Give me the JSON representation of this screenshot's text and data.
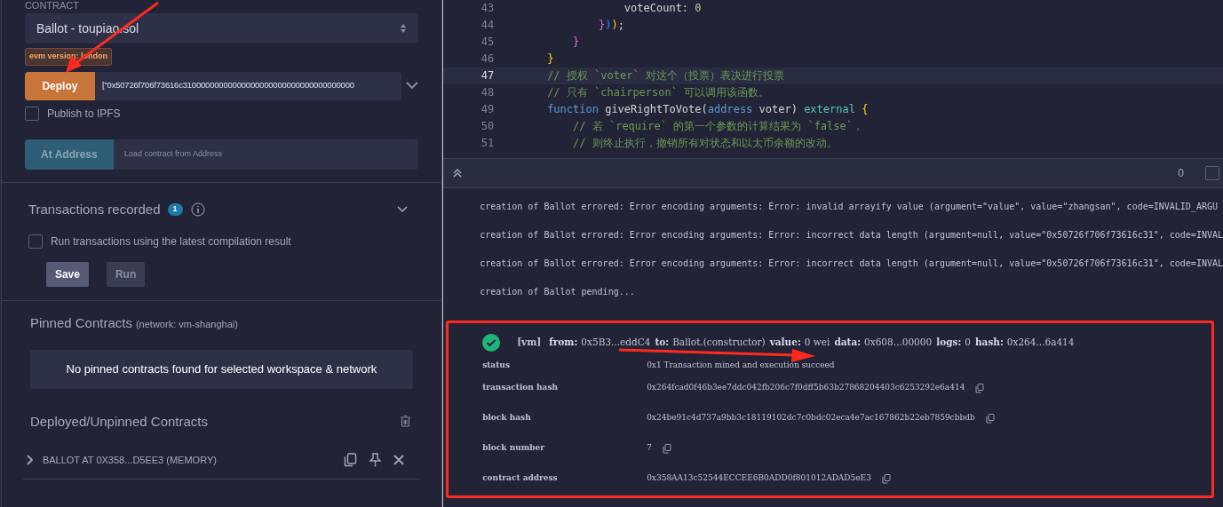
{
  "left_panel": {
    "contract_label": "CONTRACT",
    "contract_select": "Ballot - toupiao.sol",
    "evm_badge": "evm version: london",
    "deploy_button": "Deploy",
    "deploy_args": "[\"0x50726f706f73616c31000000000000000000000000000000000000",
    "publish_ipfs": {
      "label": "Publish to IPFS",
      "checked": false
    },
    "at_address_button": "At Address",
    "at_address_placeholder": "Load contract from Address",
    "transactions": {
      "title": "Transactions recorded",
      "count": "1",
      "expanded": false,
      "run_latest": {
        "label": "Run transactions using the latest compilation result",
        "checked": false
      },
      "buttons": [
        {
          "label": "Save",
          "disabled": false
        },
        {
          "label": "Run",
          "disabled": true
        }
      ]
    },
    "pinned": {
      "title": "Pinned Contracts",
      "network": "(network: vm-shanghai)",
      "empty_message": "No pinned contracts found for selected workspace & network"
    },
    "deployed": {
      "title": "Deployed/Unpinned Contracts",
      "items": [
        {
          "label": "BALLOT AT 0X358...D5EE3 (MEMORY)",
          "expanded": false
        }
      ]
    }
  },
  "editor": {
    "lines": [
      {
        "number": "43",
        "current": false,
        "tokens": [
          {
            "text": "            voteCount: ",
            "kind": "plain"
          },
          {
            "text": "0",
            "kind": "number"
          }
        ]
      },
      {
        "number": "44",
        "current": false,
        "tokens": [
          {
            "text": "        }",
            "kind": "bracket2"
          },
          {
            "text": ")",
            "kind": "bracket3"
          },
          {
            "text": ")",
            "kind": "bracket1"
          },
          {
            "text": ";",
            "kind": "plain"
          }
        ]
      },
      {
        "number": "45",
        "current": false,
        "tokens": [
          {
            "text": "    }",
            "kind": "bracket2"
          }
        ]
      },
      {
        "number": "46",
        "current": false,
        "tokens": [
          {
            "text": "}",
            "kind": "bracket1"
          }
        ]
      },
      {
        "number": "47",
        "current": true,
        "tokens": [
          {
            "text": "// 授权 `voter` 对这个（投票）表决进行投票",
            "kind": "comment"
          }
        ]
      },
      {
        "number": "48",
        "current": false,
        "tokens": [
          {
            "text": "// 只有 `chairperson` 可以调用该函数。",
            "kind": "comment"
          }
        ]
      },
      {
        "number": "49",
        "current": false,
        "tokens": [
          {
            "text": "function",
            "kind": "keyword"
          },
          {
            "text": " giveRightToVote(",
            "kind": "plain"
          },
          {
            "text": "address",
            "kind": "keyword"
          },
          {
            "text": " voter) ",
            "kind": "plain"
          },
          {
            "text": "external",
            "kind": "modifier"
          },
          {
            "text": " {",
            "kind": "bracket1"
          }
        ]
      },
      {
        "number": "50",
        "current": false,
        "tokens": [
          {
            "text": "    // 若 `require` 的第一个参数的计算结果为 `false`，",
            "kind": "comment"
          }
        ]
      },
      {
        "number": "51",
        "current": false,
        "tokens": [
          {
            "text": "    // 则终止执行，撤销所有对状态和以太币余额的改动。",
            "kind": "comment"
          }
        ]
      }
    ]
  },
  "terminal": {
    "pending_count": "0",
    "listen_checked": false,
    "logs": [
      "creation of Ballot errored: Error encoding arguments: Error: invalid arrayify value (argument=\"value\", value=\"zhangsan\", code=INVALID_ARGU",
      "creation of Ballot errored: Error encoding arguments: Error: incorrect data length (argument=null, value=\"0x50726f706f73616c31\", code=INVAL",
      "creation of Ballot errored: Error encoding arguments: Error: incorrect data length (argument=null, value=\"0x50726f706f73616c31\", code=INVAL",
      "creation of Ballot pending..."
    ],
    "transaction": {
      "success": true,
      "summary": [
        {
          "kind": "tag",
          "text": "[vm]"
        },
        {
          "kind": "key",
          "text": "from:"
        },
        {
          "kind": "value",
          "text": "0x5B3...eddC4"
        },
        {
          "kind": "key",
          "text": "to:"
        },
        {
          "kind": "value",
          "text": "Ballot.(constructor)"
        },
        {
          "kind": "key",
          "text": "value:"
        },
        {
          "kind": "value",
          "text": "0 wei"
        },
        {
          "kind": "key",
          "text": "data:"
        },
        {
          "kind": "value",
          "text": "0x608...00000"
        },
        {
          "kind": "key",
          "text": "logs:"
        },
        {
          "kind": "value",
          "text": "0"
        },
        {
          "kind": "key",
          "text": "hash:"
        },
        {
          "kind": "value",
          "text": "0x264...6a414"
        }
      ],
      "details": [
        {
          "key": "status",
          "value": "0x1 Transaction mined and execution succeed",
          "copy": false
        },
        {
          "key": "transaction hash",
          "value": "0x264fcad0f46b3ee7ddc042fb206c7f0dff5b63b27868204403c6253292e6a414",
          "copy": true
        },
        {
          "key": "block hash",
          "value": "0x24be91c4d737a9bb3c18119102dc7c0bdc02eca4e7ac167862b22eb7859cbbdb",
          "copy": true
        },
        {
          "key": "block number",
          "value": "7",
          "copy": true
        },
        {
          "key": "contract address",
          "value": "0x358AA13c52544ECCEE6B0ADD0f801012ADAD5eE3",
          "copy": true
        }
      ]
    }
  }
}
